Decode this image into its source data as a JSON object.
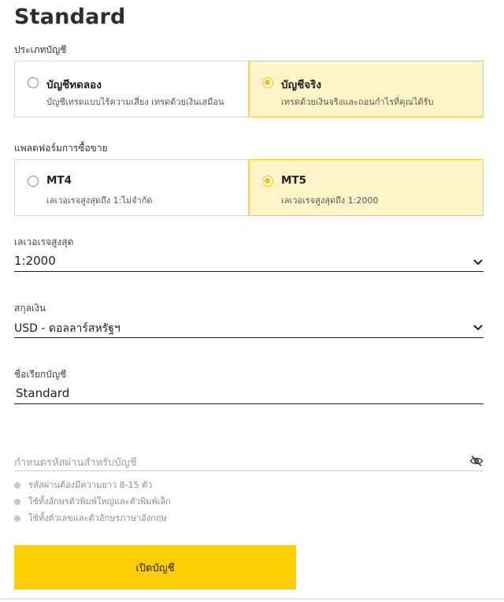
{
  "page": {
    "title": "Standard"
  },
  "account_type": {
    "label": "ประเภทบัญชี",
    "options": [
      {
        "title": "บัญชีทดลอง",
        "subtitle": "บัญชีเทรดแบบไร้ความเสี่ยง เทรดด้วยเงินเสมือน",
        "selected": false
      },
      {
        "title": "บัญชีจริง",
        "subtitle": "เทรดด้วยเงินจริงและถอนกำไรที่คุณได้รับ",
        "selected": true
      }
    ]
  },
  "platform": {
    "label": "แพลตฟอร์มการซื้อขาย",
    "options": [
      {
        "title": "MT4",
        "subtitle": "เลเวอเรจสูงสุดถึง 1:ไม่จำกัด",
        "selected": false
      },
      {
        "title": "MT5",
        "subtitle": "เลเวอเรจสูงสุดถึง 1:2000",
        "selected": true
      }
    ]
  },
  "leverage": {
    "label": "เลเวอเรจสูงสุด",
    "value": "1:2000"
  },
  "currency": {
    "label": "สกุลเงิน",
    "value": "USD - ดอลลาร์สหรัฐฯ"
  },
  "account_name": {
    "label": "ชื่อเรียกบัญชี",
    "value": "Standard"
  },
  "password": {
    "placeholder": "กำหนดรหัสผ่านสำหรับบัญชี",
    "rules": [
      "รหัสผ่านต้องมีความยาว 8-15 ตัว",
      "ใช้ทั้งอักษรตัวพิมพ์ใหญ่และตัวพิมพ์เล็ก",
      "ใช้ทั้งตัวเลขและตัวอักษรภาษาอังกฤษ"
    ]
  },
  "submit": {
    "label": "เปิดบัญชี"
  },
  "colors": {
    "accent": "#ffcf01",
    "selected_bg": "#fff5c9",
    "selected_border": "#f2cf2a",
    "radio_on": "#f5c400"
  },
  "icons": {
    "dropdown": "chevron-down-icon",
    "password_toggle": "eye-slash-icon"
  }
}
